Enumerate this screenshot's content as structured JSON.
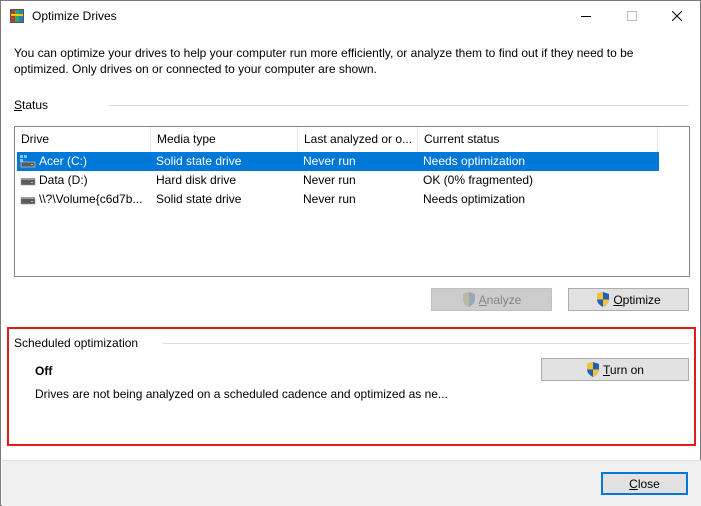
{
  "window": {
    "title": "Optimize Drives"
  },
  "intro": {
    "text": "You can optimize your drives to help your computer run more efficiently, or analyze them to find out if they need to be optimized. Only drives on or connected to your computer are shown."
  },
  "status": {
    "label_first": "S",
    "label_rest": "tatus"
  },
  "table": {
    "columns": [
      "Drive",
      "Media type",
      "Last analyzed or o...",
      "Current status"
    ],
    "rows": [
      {
        "drive": "Acer (C:)",
        "media": "Solid state drive",
        "last": "Never run",
        "status": "Needs optimization",
        "icon": "windows-drive-icon",
        "selected": true
      },
      {
        "drive": "Data (D:)",
        "media": "Hard disk drive",
        "last": "Never run",
        "status": "OK (0% fragmented)",
        "icon": "hard-drive-icon",
        "selected": false
      },
      {
        "drive": "\\\\?\\Volume{c6d7b...",
        "media": "Solid state drive",
        "last": "Never run",
        "status": "Needs optimization",
        "icon": "hard-drive-icon",
        "selected": false
      }
    ]
  },
  "actions": {
    "analyze_first": "A",
    "analyze_rest": "nalyze",
    "optimize_first": "O",
    "optimize_rest": "ptimize"
  },
  "scheduled": {
    "label": "Scheduled optimization",
    "state": "Off",
    "description": "Drives are not being analyzed on a scheduled cadence and optimized as ne...",
    "turn_on_first": "T",
    "turn_on_rest": "urn on"
  },
  "footer": {
    "close_first": "C",
    "close_rest": "lose"
  },
  "colors": {
    "selection": "#0078d7",
    "highlight_border": "#e01b1b",
    "disabled_button": "#cccccc"
  }
}
